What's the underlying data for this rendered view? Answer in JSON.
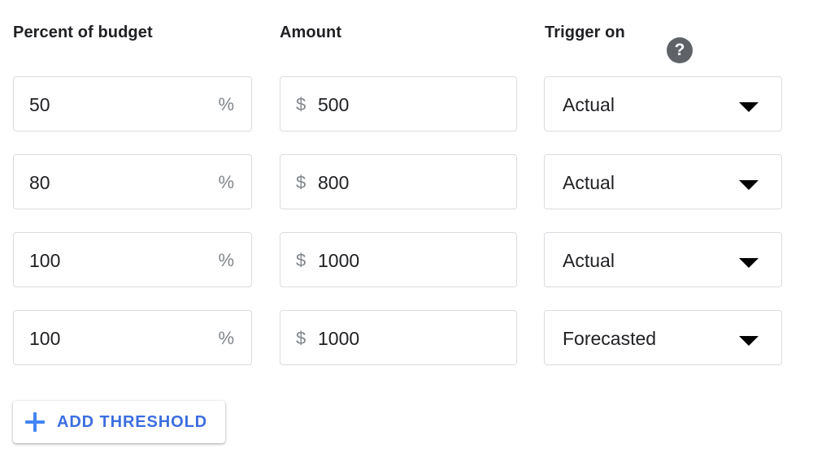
{
  "columns": {
    "percent_label": "Percent of budget",
    "amount_label": "Amount",
    "trigger_label": "Trigger on",
    "help_icon": "help-icon",
    "help_glyph": "?"
  },
  "rows": [
    {
      "percent_value": "50",
      "percent_suffix": "%",
      "amount_prefix": "$",
      "amount_value": "500",
      "trigger_value": "Actual",
      "caret_icon": "chevron-down-icon"
    },
    {
      "percent_value": "80",
      "percent_suffix": "%",
      "amount_prefix": "$",
      "amount_value": "800",
      "trigger_value": "Actual",
      "caret_icon": "chevron-down-icon"
    },
    {
      "percent_value": "100",
      "percent_suffix": "%",
      "amount_prefix": "$",
      "amount_value": "1000",
      "trigger_value": "Actual",
      "caret_icon": "chevron-down-icon"
    },
    {
      "percent_value": "100",
      "percent_suffix": "%",
      "amount_prefix": "$",
      "amount_value": "1000",
      "trigger_value": "Forecasted",
      "caret_icon": "chevron-down-icon"
    }
  ],
  "trigger_options": [
    "Actual",
    "Forecasted"
  ],
  "add_button": {
    "label": "ADD THRESHOLD",
    "icon": "plus-icon"
  },
  "colors": {
    "accent_blue": "#3c6ee0",
    "plus_blue": "#4285f4",
    "border_gray": "#dadce0",
    "text_primary": "#202124",
    "text_secondary": "#80868b",
    "help_circle": "#5f6368",
    "background": "#ffffff"
  }
}
